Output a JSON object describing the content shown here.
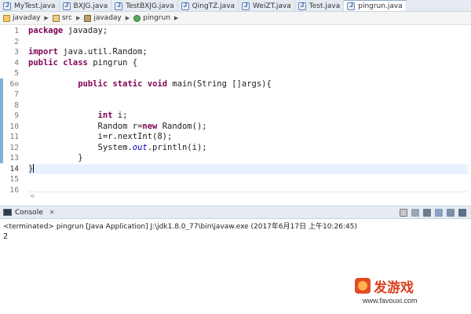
{
  "editor_tabs": [
    {
      "label": "MyTest.java"
    },
    {
      "label": "BXJG.java"
    },
    {
      "label": "TestBXJG.java"
    },
    {
      "label": "QingTZ.java"
    },
    {
      "label": "WeiZT.java"
    },
    {
      "label": "Test.java"
    },
    {
      "label": "pingrun.java"
    }
  ],
  "breadcrumb": [
    "javaday",
    "src",
    "javaday",
    "pingrun"
  ],
  "editor": {
    "line_numbers": [
      "1",
      "2",
      "3",
      "4",
      "5",
      "6⊖",
      "7",
      "8",
      "9",
      "10",
      "11",
      "12",
      "13",
      "14",
      "15",
      "16"
    ],
    "code": [
      [
        {
          "t": "package",
          "c": "kw"
        },
        {
          "t": " javaday;"
        }
      ],
      [],
      [
        {
          "t": "import",
          "c": "kw"
        },
        {
          "t": " java.util.Random;"
        }
      ],
      [
        {
          "t": "public",
          "c": "kw"
        },
        {
          "t": " "
        },
        {
          "t": "class",
          "c": "kw"
        },
        {
          "t": " pingrun {"
        }
      ],
      [],
      [
        {
          "t": "          "
        },
        {
          "t": "public",
          "c": "kw"
        },
        {
          "t": " "
        },
        {
          "t": "static",
          "c": "kw"
        },
        {
          "t": " "
        },
        {
          "t": "void",
          "c": "kw"
        },
        {
          "t": " main(String []args){"
        }
      ],
      [],
      [],
      [
        {
          "t": "              "
        },
        {
          "t": "int",
          "c": "kw"
        },
        {
          "t": " i;"
        }
      ],
      [
        {
          "t": "              Random r="
        },
        {
          "t": "new",
          "c": "kw"
        },
        {
          "t": " Random();"
        }
      ],
      [
        {
          "t": "              i=r.nextInt(8);"
        }
      ],
      [
        {
          "t": "              System."
        },
        {
          "t": "out",
          "c": "st"
        },
        {
          "t": ".println(i);"
        }
      ],
      [
        {
          "t": "          }"
        }
      ],
      [
        {
          "t": "}"
        }
      ],
      [],
      []
    ],
    "current_line": 14,
    "scroll_marker": "<"
  },
  "console": {
    "title": "Console",
    "close": "✕",
    "terminated": "<terminated> pingrun [Java Application] J:\\jdk1.8.0_77\\bin\\javaw.exe (2017年6月17日 上午10:26:45)",
    "output": "2"
  },
  "watermark": {
    "brand": "发游戏",
    "url": "www.favouxi.com"
  },
  "colors": {
    "keyword": "#7f0055",
    "static_field": "#0000c0",
    "current_line_bg": "#e8f2fe"
  }
}
